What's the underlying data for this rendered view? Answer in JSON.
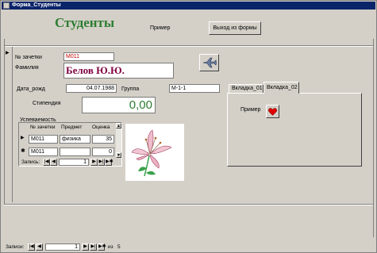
{
  "window": {
    "title": "Форма_Студенты"
  },
  "header": {
    "title": "Студенты",
    "primer_label": "Пример",
    "exit_button": "Выход из формы"
  },
  "record_selector": {
    "glyph": "▶"
  },
  "form": {
    "zachetka_label": "№ зачетки",
    "zachetka_value": "М011",
    "familia_label": "Фамилия",
    "familia_value": "Белов Ю.Ю.",
    "dob_label": "Дата_рожд",
    "dob_value": "04.07.1988",
    "group_label": "Группа",
    "group_value": "М-1-1",
    "stipend_label": "Стипендия",
    "stipend_value": "0,00",
    "plane_icon": "airplane-icon"
  },
  "subform": {
    "title": "Успеваемость",
    "columns": [
      "№ зачетки",
      "Предмет",
      "Оценка"
    ],
    "rows": [
      {
        "marker": "▶",
        "zachetka": "М011",
        "predmet": "физика",
        "ocenka": "35"
      },
      {
        "marker": "✱",
        "zachetka": "М011",
        "predmet": "",
        "ocenka": "0"
      }
    ],
    "nav": {
      "label": "Запись:",
      "value": "1"
    }
  },
  "tabs": {
    "items": [
      "Вкладка_01",
      "Вкладка_02"
    ],
    "active": 1,
    "content_label": "Пример",
    "heart_icon": "heart-icon"
  },
  "image": {
    "icon": "lily-flower-icon"
  },
  "bottom_nav": {
    "label": "Записи:",
    "value": "1",
    "of_label": "из",
    "total": "5"
  },
  "colors": {
    "title_green": "#2e7d32",
    "name_maroon": "#800040",
    "titlebar": "#0a246a",
    "field_red": "#c00000",
    "heart_red": "#e00000"
  }
}
